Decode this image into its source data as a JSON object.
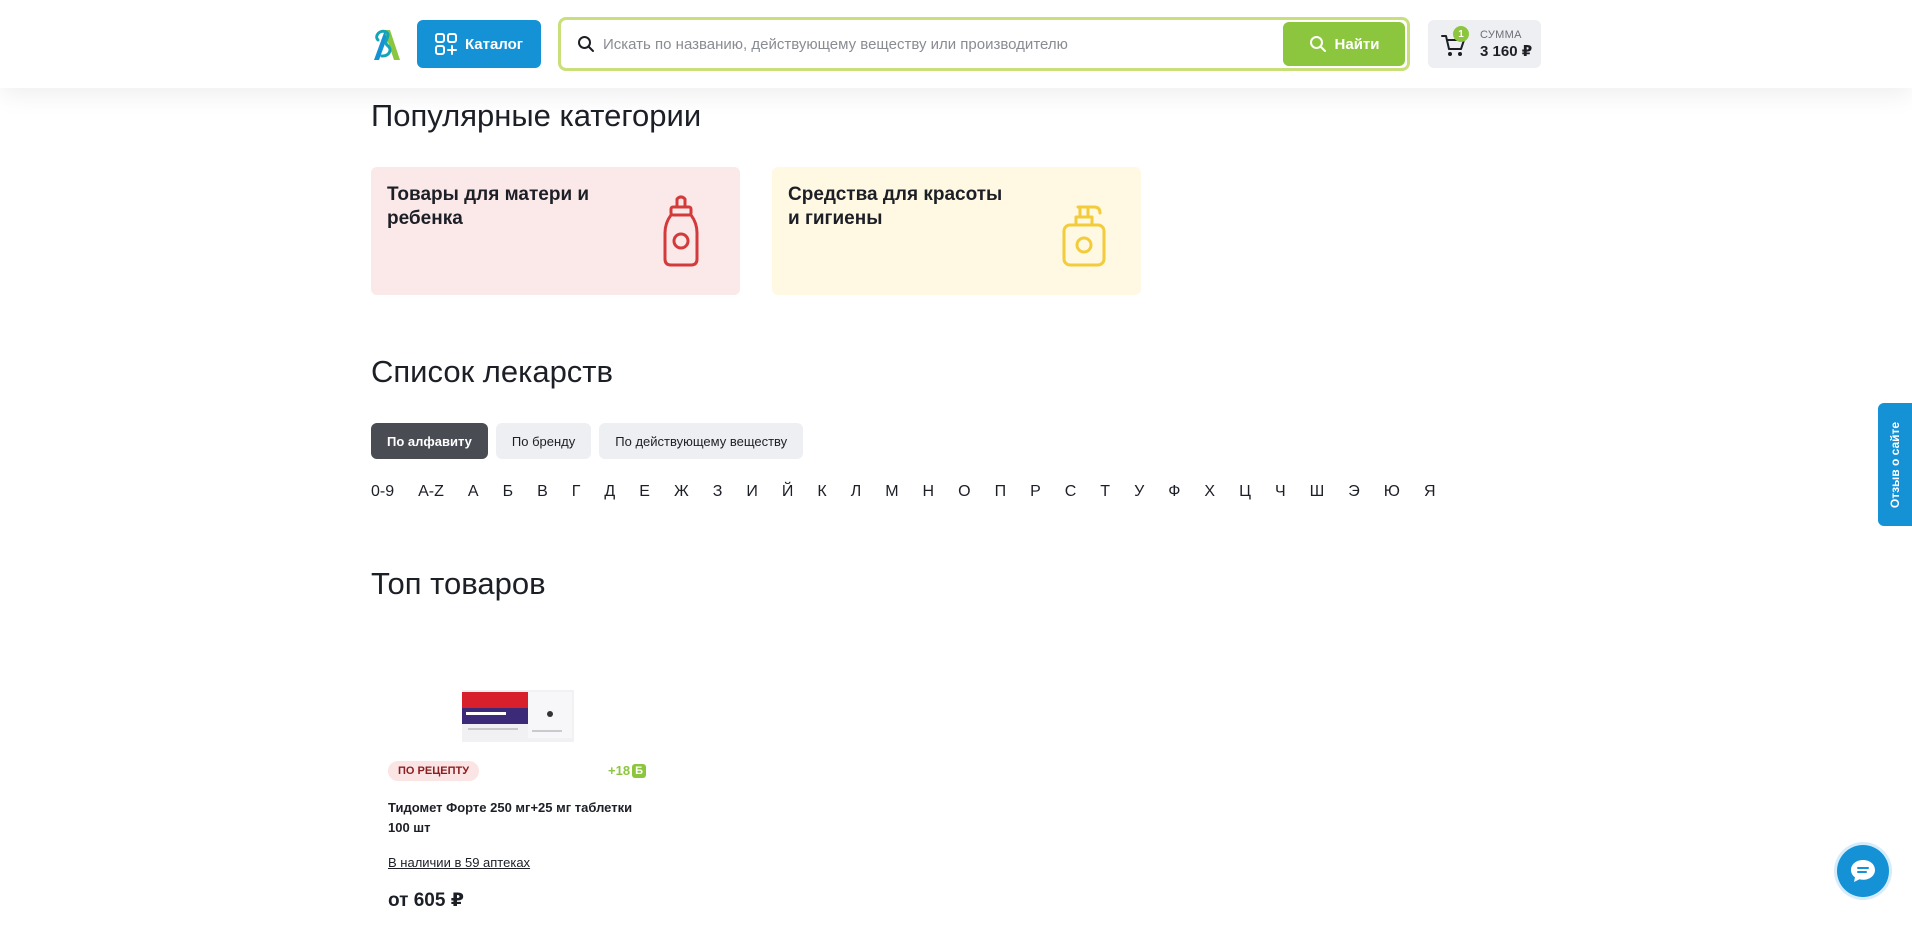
{
  "header": {
    "catalog_label": "Каталог",
    "search_placeholder": "Искать по названию, действующему веществу или производителю",
    "search_value": "",
    "find_label": "Найти",
    "cart": {
      "count": "1",
      "sum_label": "СУММА",
      "sum_value": "3 160 ₽"
    }
  },
  "popular": {
    "title": "Популярные категории",
    "cards": [
      {
        "title": "Товары для матери и ребенка",
        "icon": "baby-bottle-icon",
        "bg": "#fbe8e9",
        "color": "#d33a3a"
      },
      {
        "title": "Средства для красоты и гигиены",
        "icon": "soap-dispenser-icon",
        "bg": "#fff8e3",
        "color": "#f2cc3a"
      }
    ]
  },
  "drugs": {
    "title": "Список лекарств",
    "tabs": [
      "По алфавиту",
      "По бренду",
      "По действующему веществу"
    ],
    "letters": [
      "0-9",
      "A-Z",
      "А",
      "Б",
      "В",
      "Г",
      "Д",
      "Е",
      "Ж",
      "З",
      "И",
      "Й",
      "К",
      "Л",
      "М",
      "Н",
      "О",
      "П",
      "Р",
      "С",
      "Т",
      "У",
      "Ф",
      "Х",
      "Ц",
      "Ч",
      "Ш",
      "Э",
      "Ю",
      "Я"
    ]
  },
  "top": {
    "title": "Топ товаров",
    "products": [
      {
        "badge": "ПО РЕЦЕПТУ",
        "bonus": "+18",
        "bonus_icon": "Б",
        "name": "Тидомет Форте 250 мг+25 мг таблетки 100 шт",
        "availability": "В наличии в 59 аптеках",
        "price": "от 605 ₽"
      }
    ]
  },
  "feedback_label": "Отзыв о сайте",
  "colors": {
    "brand_blue": "#1592d6",
    "brand_green": "#8cc63f",
    "search_border": "#c9e07a"
  }
}
